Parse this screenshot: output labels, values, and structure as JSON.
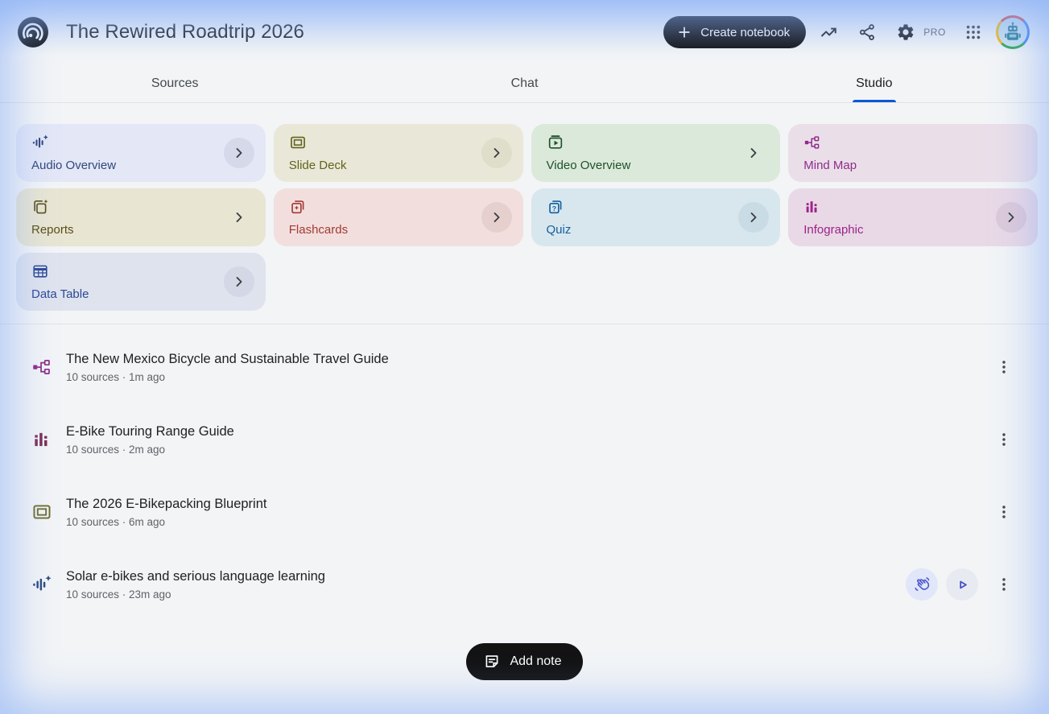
{
  "header": {
    "title": "The Rewired Roadtrip 2026",
    "create_button_label": "Create notebook",
    "pro_label": "PRO",
    "accent_black": "#131314"
  },
  "tabs": [
    {
      "label": "Sources",
      "active": false
    },
    {
      "label": "Chat",
      "active": false
    },
    {
      "label": "Studio",
      "active": true
    }
  ],
  "tab_underline_color": "#0b57d0",
  "studio": {
    "cards": [
      {
        "label": "Audio Overview",
        "bg": "#e3e7f6",
        "fg": "#32477e",
        "icon": "audio-waveform-sparkle-icon",
        "chevron": "circle"
      },
      {
        "label": "Slide Deck",
        "bg": "#e9e8d8",
        "fg": "#63621d",
        "icon": "slide-deck-icon",
        "chevron": "circle"
      },
      {
        "label": "Video Overview",
        "bg": "#dbe9da",
        "fg": "#20512a",
        "icon": "video-overview-icon",
        "chevron": "plain"
      },
      {
        "label": "Mind Map",
        "bg": "#eadfe9",
        "fg": "#8f2c8a",
        "icon": "mind-map-icon",
        "chevron": "none"
      },
      {
        "label": "Reports",
        "bg": "#e8e5d3",
        "fg": "#5a4f16",
        "icon": "reports-sparkle-icon",
        "chevron": "plain"
      },
      {
        "label": "Flashcards",
        "bg": "#f2dfdd",
        "fg": "#a23936",
        "icon": "flashcards-icon",
        "chevron": "circle"
      },
      {
        "label": "Quiz",
        "bg": "#d8e7ee",
        "fg": "#13609f",
        "icon": "quiz-icon",
        "chevron": "circle"
      },
      {
        "label": "Infographic",
        "bg": "#e9d9e6",
        "fg": "#9c2388",
        "icon": "infographic-bars-icon",
        "chevron": "circle"
      },
      {
        "label": "Data Table",
        "bg": "#dfe3ee",
        "fg": "#2b4896",
        "icon": "data-table-icon",
        "chevron": "circle"
      }
    ]
  },
  "documents": [
    {
      "title": "The New Mexico Bicycle and Sustainable Travel Guide",
      "meta": "10 sources · 1m ago",
      "icon": "mind-map-icon",
      "fg": "#8f2c8a",
      "has_audio_actions": false
    },
    {
      "title": "E-Bike Touring Range Guide",
      "meta": "10 sources · 2m ago",
      "icon": "infographic-bars-icon",
      "fg": "#7e2c58",
      "has_audio_actions": false
    },
    {
      "title": "The 2026 E-Bikepacking Blueprint",
      "meta": "10 sources · 6m ago",
      "icon": "slide-deck-icon",
      "fg": "#6e6b2e",
      "has_audio_actions": false
    },
    {
      "title": "Solar e-bikes and serious language learning",
      "meta": "10 sources · 23m ago",
      "icon": "audio-waveform-sparkle-icon",
      "fg": "#2f4a7d",
      "has_audio_actions": true
    }
  ],
  "add_note_label": "Add note"
}
